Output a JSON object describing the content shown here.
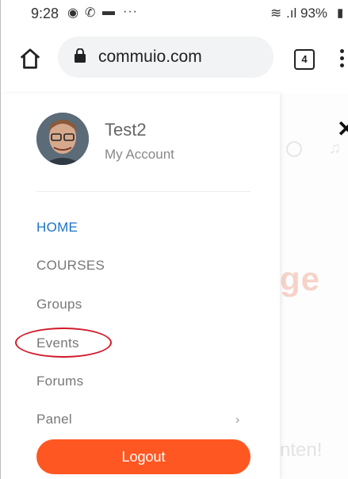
{
  "status_bar": {
    "time": "9:28",
    "more": "···",
    "battery": "93%",
    "icons": [
      "target-icon",
      "whatsapp-icon",
      "message-icon",
      "wifi-icon",
      "signal-icon",
      "battery-icon"
    ]
  },
  "browser": {
    "url": "commuio.com",
    "tab_count": "4",
    "icons": [
      "home-icon",
      "lock-icon",
      "more-vert-icon"
    ]
  },
  "drawer": {
    "user_name": "Test2",
    "account_link": "My Account",
    "nav": [
      {
        "label": "HOME",
        "active": true
      },
      {
        "label": "COURSES"
      },
      {
        "label": "Groups"
      },
      {
        "label": "Events"
      },
      {
        "label": "Forums"
      },
      {
        "label": "Panel",
        "has_chevron": true
      }
    ],
    "logout_label": "Logout",
    "accent": "#ff5722",
    "active_color": "#1a73c8"
  },
  "background_page": {
    "headline_fragment": "ge",
    "footer_fragment": "nten!",
    "close_symbol": "✕"
  },
  "annotation": {
    "target": "Events",
    "color": "#d11a2a"
  }
}
